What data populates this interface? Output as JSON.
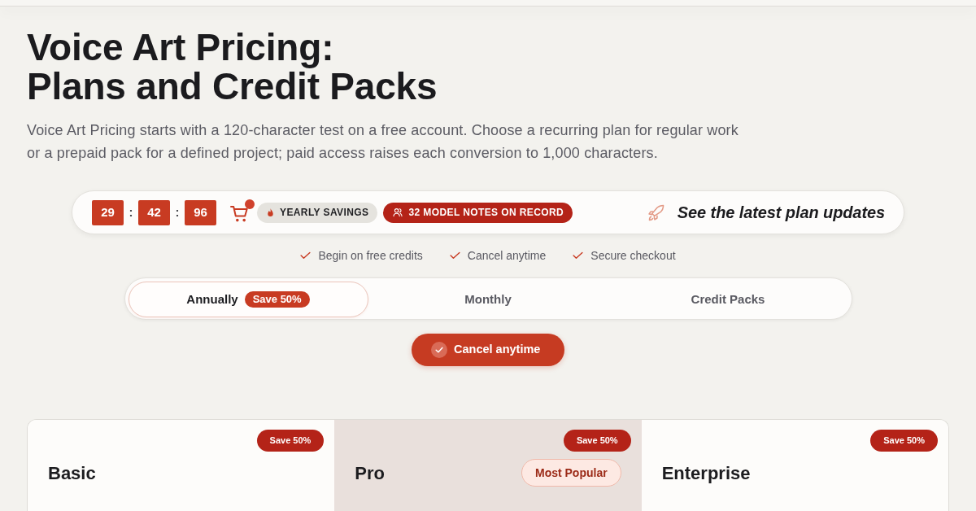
{
  "header": {
    "title_lines": [
      "Voice Art Pricing:",
      "Plans and Credit Packs"
    ],
    "intro": "Voice Art Pricing starts with a 120-character test on a free account. Choose a recurring plan for regular work or a prepaid pack for a defined project; paid access raises each conversion to 1,000 characters."
  },
  "promo_bar": {
    "timer": {
      "units": [
        "29",
        "42",
        "96"
      ],
      "separator": ":"
    },
    "cart": {
      "notification": true
    },
    "tags": [
      {
        "kind": "neutral",
        "label": "YEARLY SAVINGS"
      },
      {
        "kind": "accent",
        "label": "32 MODEL NOTES ON RECORD"
      }
    ],
    "link": "See the latest plan updates"
  },
  "assurances": [
    "Begin on free credits",
    "Cancel anytime",
    "Secure checkout"
  ],
  "billing_tabs": [
    {
      "label": "Annually",
      "badge": "Save 50%",
      "selected": true
    },
    {
      "label": "Monthly",
      "selected": false
    },
    {
      "label": "Credit Packs",
      "selected": false
    }
  ],
  "cancel_button": {
    "label": "Cancel anytime"
  },
  "plans": [
    {
      "name": "Basic",
      "badge": "Save 50%",
      "featured": false
    },
    {
      "name": "Pro",
      "badge": "Save 50%",
      "featured": true,
      "tag": "Most Popular"
    },
    {
      "name": "Enterprise",
      "badge": "Save 50%",
      "featured": false
    }
  ]
}
